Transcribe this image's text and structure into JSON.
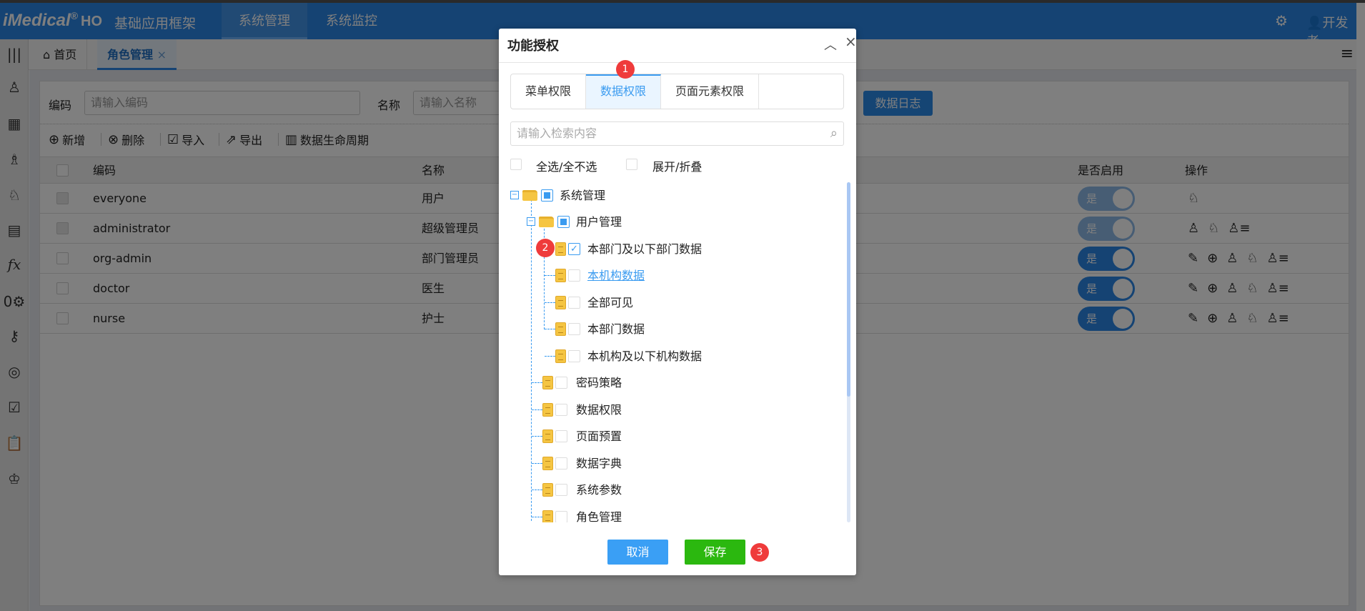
{
  "header": {
    "logo": "iMedical",
    "logo_reg": "®",
    "logo_suffix": "HO",
    "subtitle": "基础应用框架",
    "menu": [
      {
        "label": "系统管理",
        "active": true
      },
      {
        "label": "系统监控",
        "active": false
      }
    ],
    "user": "开发者"
  },
  "tabs": [
    {
      "label": "首页"
    },
    {
      "label": "角色管理",
      "close": "×"
    }
  ],
  "search": {
    "code_label": "编码",
    "code_placeholder": "请输入编码",
    "name_label": "名称",
    "name_placeholder": "请输入名称",
    "log_button": "数据日志"
  },
  "toolbar": {
    "add": "新增",
    "delete": "删除",
    "import": "导入",
    "export": "导出",
    "lifecycle": "数据生命周期"
  },
  "table": {
    "columns": {
      "code": "编码",
      "name": "名称",
      "enabled": "是否启用",
      "actions": "操作"
    },
    "rows": [
      {
        "code": "everyone",
        "name": "用户",
        "enabled": "是"
      },
      {
        "code": "administrator",
        "name": "超级管理员",
        "enabled": "是"
      },
      {
        "code": "org-admin",
        "name": "部门管理员",
        "enabled": "是"
      },
      {
        "code": "doctor",
        "name": "医生",
        "enabled": "是"
      },
      {
        "code": "nurse",
        "name": "护士",
        "enabled": "是"
      }
    ]
  },
  "dialog": {
    "title": "功能授权",
    "tabs": [
      {
        "label": "菜单权限"
      },
      {
        "label": "数据权限",
        "active": true
      },
      {
        "label": "页面元素权限"
      }
    ],
    "search_placeholder": "请输入检索内容",
    "select_all": "全选/全不选",
    "expand_collapse": "展开/折叠",
    "tree": [
      {
        "label": "系统管理",
        "state": "partial"
      },
      {
        "label": "用户管理",
        "state": "partial"
      },
      {
        "label": "本部门及以下部门数据",
        "state": "checked"
      },
      {
        "label": "本机构数据",
        "state": "unchecked"
      },
      {
        "label": "全部可见",
        "state": "unchecked"
      },
      {
        "label": "本部门数据",
        "state": "unchecked"
      },
      {
        "label": "本机构及以下机构数据",
        "state": "unchecked"
      },
      {
        "label": "密码策略",
        "state": "unchecked"
      },
      {
        "label": "数据权限",
        "state": "unchecked"
      },
      {
        "label": "页面预置",
        "state": "unchecked"
      },
      {
        "label": "数据字典",
        "state": "unchecked"
      },
      {
        "label": "系统参数",
        "state": "unchecked"
      },
      {
        "label": "角色管理",
        "state": "unchecked"
      }
    ],
    "cancel": "取消",
    "save": "保存",
    "badges": [
      "1",
      "2",
      "3"
    ]
  },
  "colors": {
    "header": "#2a86e6",
    "accent": "#3a9bf0",
    "save": "#2bb80f",
    "cancel": "#3a9ff5",
    "badge": "#ef3b3b"
  }
}
